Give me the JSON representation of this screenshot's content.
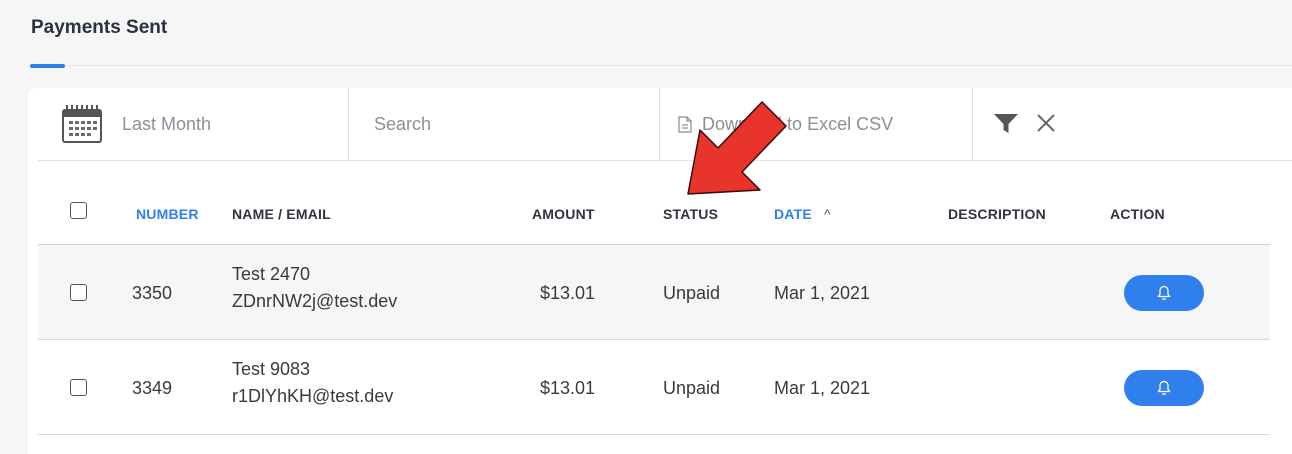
{
  "header": {
    "title": "Payments Sent"
  },
  "toolbar": {
    "date_range": "Last Month",
    "search_placeholder": "Search",
    "download_label": "Download to Excel CSV",
    "icons": [
      "calendar-icon",
      "document-icon",
      "filter-icon",
      "close-icon"
    ]
  },
  "table": {
    "columns": {
      "number": "NUMBER",
      "name_email": "NAME / EMAIL",
      "amount": "AMOUNT",
      "status": "STATUS",
      "date": "DATE",
      "description": "DESCRIPTION",
      "action": "ACTION"
    },
    "sort": {
      "column": "date",
      "direction": "ascending",
      "indicator": "^"
    },
    "rows": [
      {
        "number": "3350",
        "name": "Test 2470",
        "email": "ZDnrNW2j@test.dev",
        "amount": "$13.01",
        "status": "Unpaid",
        "date": "Mar 1, 2021",
        "description": "",
        "action_icon": "bell-icon"
      },
      {
        "number": "3349",
        "name": "Test 9083",
        "email": "r1DlYhKH@test.dev",
        "amount": "$13.01",
        "status": "Unpaid",
        "date": "Mar 1, 2021",
        "description": "",
        "action_icon": "bell-icon"
      }
    ]
  },
  "colors": {
    "accent": "#2f80ed",
    "annotation_arrow": "#e8342a",
    "row_alt": "#f5f6f8"
  }
}
